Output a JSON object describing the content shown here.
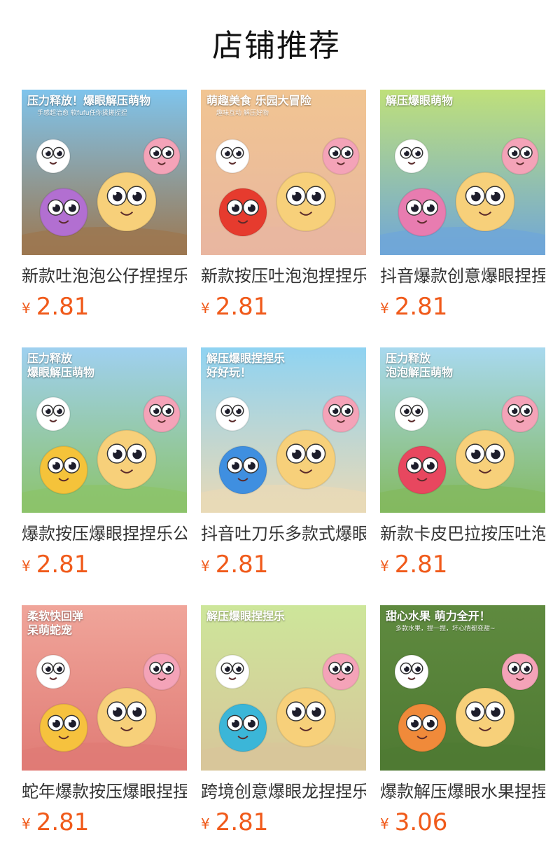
{
  "section": {
    "title": "店铺推荐"
  },
  "products": [
    {
      "title": "新款吐泡泡公仔捏捏乐",
      "currency": "¥",
      "price": "2.81",
      "image_caption": "压力释放！爆眼解压萌物",
      "image_subcaption": "手感超治愈  软fufu任你揉搓捏捏",
      "colors": {
        "top": "#7fc4ec",
        "bottom": "#9c7750",
        "accent": "#b26fd1"
      }
    },
    {
      "title": "新款按压吐泡泡捏捏乐",
      "currency": "¥",
      "price": "2.81",
      "image_caption": "萌趣美食 乐园大冒险",
      "image_subcaption": "趣味互动  解压好物",
      "colors": {
        "top": "#f1c592",
        "bottom": "#e8b6a0",
        "accent": "#e63b2e"
      }
    },
    {
      "title": "抖音爆款创意爆眼捏捏乐",
      "currency": "¥",
      "price": "2.81",
      "image_caption": "解压爆眼萌物",
      "image_subcaption": "",
      "colors": {
        "top": "#bfe07a",
        "bottom": "#6fa6d8",
        "accent": "#e87cb0"
      }
    },
    {
      "title": "爆款按压爆眼捏捏乐公仔",
      "currency": "¥",
      "price": "2.81",
      "image_caption": "压力释放\n爆眼解压萌物",
      "image_subcaption": "",
      "colors": {
        "top": "#9fd0f0",
        "bottom": "#8cc36a",
        "accent": "#f5c33a"
      }
    },
    {
      "title": "抖音吐刀乐多款式爆眼捏捏",
      "currency": "¥",
      "price": "2.81",
      "image_caption": "解压爆眼捏捏乐\n好好玩！",
      "image_subcaption": "",
      "colors": {
        "top": "#8fd3f2",
        "bottom": "#e9d9b6",
        "accent": "#3f8fe0"
      }
    },
    {
      "title": "新款卡皮巴拉按压吐泡泡",
      "currency": "¥",
      "price": "2.81",
      "image_caption": "压力释放\n泡泡解压萌物",
      "image_subcaption": "",
      "colors": {
        "top": "#a8d9ef",
        "bottom": "#83b95f",
        "accent": "#e8475f"
      }
    },
    {
      "title": "蛇年爆款按压爆眼捏捏乐",
      "currency": "¥",
      "price": "2.81",
      "image_caption": "柔软快回弹\n呆萌蛇宠",
      "image_subcaption": "",
      "colors": {
        "top": "#f0a59a",
        "bottom": "#e07b75",
        "accent": "#f6c23e"
      }
    },
    {
      "title": "跨境创意爆眼龙捏捏乐",
      "currency": "¥",
      "price": "2.81",
      "image_caption": "解压爆眼捏捏乐",
      "image_subcaption": "",
      "colors": {
        "top": "#cde69a",
        "bottom": "#d8c59a",
        "accent": "#3bb6d8"
      }
    },
    {
      "title": "爆款解压爆眼水果捏捏乐",
      "currency": "¥",
      "price": "3.06",
      "image_caption": "甜心水果 萌力全开！",
      "image_subcaption": "多款水果，捏一捏，坏心情都变甜~",
      "colors": {
        "top": "#5f8a3f",
        "bottom": "#4f7a33",
        "accent": "#f08a3a"
      }
    }
  ]
}
